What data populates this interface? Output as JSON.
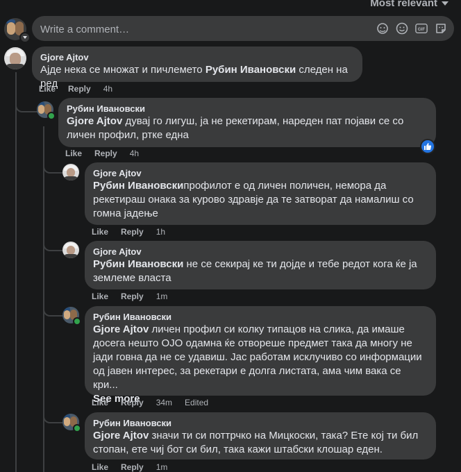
{
  "sort": {
    "label": "Most relevant"
  },
  "composer": {
    "placeholder": "Write a comment…"
  },
  "icons": {
    "composer": [
      "sticker-face-icon",
      "emoji-icon",
      "gif-icon",
      "sticker-icon"
    ],
    "like_reaction": "thumbs-up-icon"
  },
  "colors": {
    "background": "#18191a",
    "bubble": "#3a3b3c",
    "link_blue": "#2374e1",
    "online": "#31a24c"
  },
  "comments": [
    {
      "author": "Gjore Ajtov",
      "text": "Ајде нека се множат и пичлемето ",
      "mention": "Рубин Ивановски",
      "text_after": " следен на ред",
      "like": "Like",
      "reply": "Reply",
      "time": "4h"
    },
    {
      "author": "Рубин Ивановски",
      "mention": "Gjore Ajtov",
      "text": " дувај го лигуш, ја не рекетирам, нареден пат појави се со личен профил, ртке една",
      "like": "Like",
      "reply": "Reply",
      "time": "4h"
    },
    {
      "author": "Gjore Ajtov",
      "mention": "Рубин Ивановски",
      "text": "профилот е од личен поличен, немора да рекетираш онака за курово здравје да те затворат да намалиш со гомна јадење",
      "like": "Like",
      "reply": "Reply",
      "time": "1h"
    },
    {
      "author": "Gjore Ajtov",
      "mention": "Рубин Ивановски",
      "text": " не се секирај ке ти дојде и тебе редот кога ќе ја землеме власта",
      "like": "Like",
      "reply": "Reply",
      "time": "1m"
    },
    {
      "author": "Рубин Ивановски",
      "mention": "Gjore Ajtov",
      "text": " личен профил си колку типацов на слика, да имаше досега нешто ОЈО одамна ќе отвореше предмет така да многу не јади говна да не се удавиш. Јас работам исклучиво со информации од јавен интерес, за рекетари е долга листата, ама чим вака се кри...",
      "see_more": "See more",
      "like": "Like",
      "reply": "Reply",
      "time": "34m",
      "edited": "Edited"
    },
    {
      "author": "Рубин Ивановски",
      "mention": "Gjore Ajtov",
      "text": " значи ти си поттрчко на Мицкоски, така? Ете кој ти бил стопан, ете чиј бот си бил, така кажи штабски клошар еден.",
      "like": "Like",
      "reply": "Reply",
      "time": "1m"
    }
  ]
}
